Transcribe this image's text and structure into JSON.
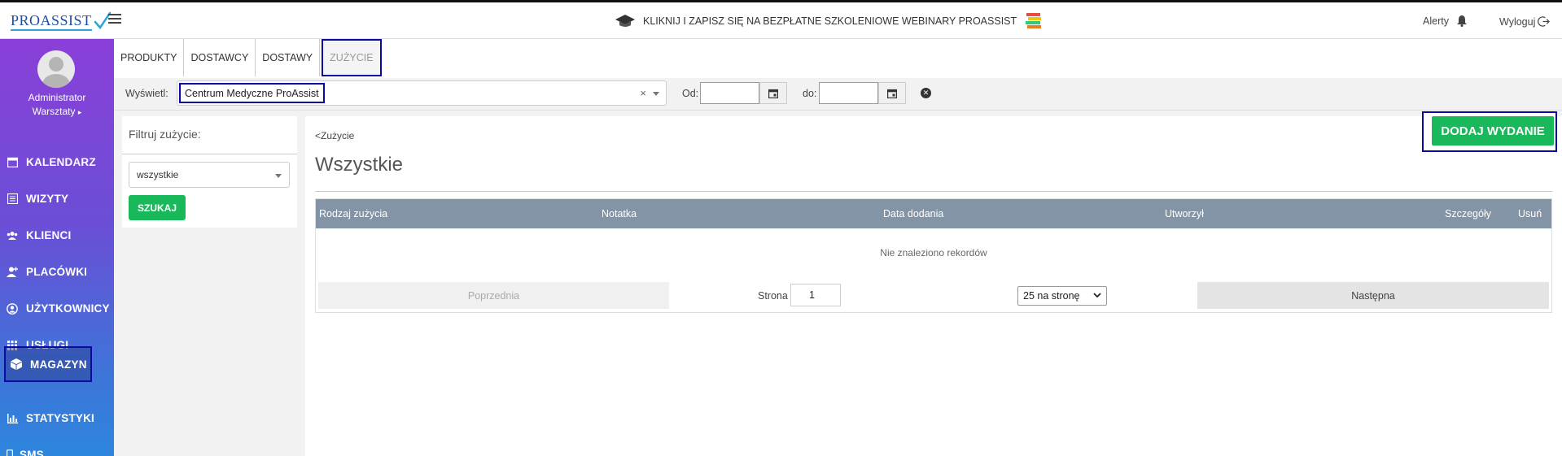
{
  "header": {
    "logo_text": "PROASSIST",
    "webinar_text": "KLIKNIJ I ZAPISZ SIĘ NA BEZPŁATNE SZKOLENIOWE WEBINARY PROASSIST",
    "alerts_label": "Alerty",
    "logout_label": "Wyloguj"
  },
  "sidebar": {
    "user_name": "Administrator",
    "user_role": "Warsztaty",
    "items": [
      {
        "label": "KALENDARZ",
        "icon": "calendar-icon"
      },
      {
        "label": "WIZYTY",
        "icon": "list-icon"
      },
      {
        "label": "KLIENCI",
        "icon": "users-icon"
      },
      {
        "label": "PLACÓWKI",
        "icon": "user-plus-icon"
      },
      {
        "label": "UŻYTKOWNICY",
        "icon": "user-circle-icon"
      },
      {
        "label": "USŁUGI",
        "icon": "grid-icon"
      },
      {
        "label": "MAGAZYN",
        "icon": "box-icon",
        "active": true
      },
      {
        "label": "STATYSTYKI",
        "icon": "bar-chart-icon"
      },
      {
        "label": "SMS",
        "icon": "phone-icon"
      }
    ]
  },
  "tabs": [
    {
      "label": "PRODUKTY"
    },
    {
      "label": "DOSTAWCY"
    },
    {
      "label": "DOSTAWY"
    },
    {
      "label": "ZUŻYCIE",
      "active": true
    }
  ],
  "filterbar": {
    "show_label": "Wyświetl:",
    "location_value": "Centrum Medyczne ProAssist",
    "from_label": "Od:",
    "from_value": "",
    "to_label": "do:",
    "to_value": ""
  },
  "filter_panel": {
    "title": "Filtruj zużycie:",
    "select_value": "wszystkie",
    "search_label": "SZUKAJ"
  },
  "main": {
    "back_link": "<Zużycie",
    "title": "Wszystkie",
    "add_button": "DODAJ WYDANIE",
    "columns": [
      "Rodzaj zużycia",
      "Notatka",
      "Data dodania",
      "Utworzył",
      "Szczegóły",
      "Usuń"
    ],
    "empty_text": "Nie znaleziono rekordów",
    "pager": {
      "prev": "Poprzednia",
      "page_label": "Strona",
      "page_value": "1",
      "page_size": "25 na stronę",
      "next": "Następna"
    }
  },
  "colors": {
    "accent_green": "#19b85a",
    "table_header": "#8294a6",
    "sidebar_top": "#8a3fd8",
    "sidebar_bottom": "#2d86dd"
  }
}
